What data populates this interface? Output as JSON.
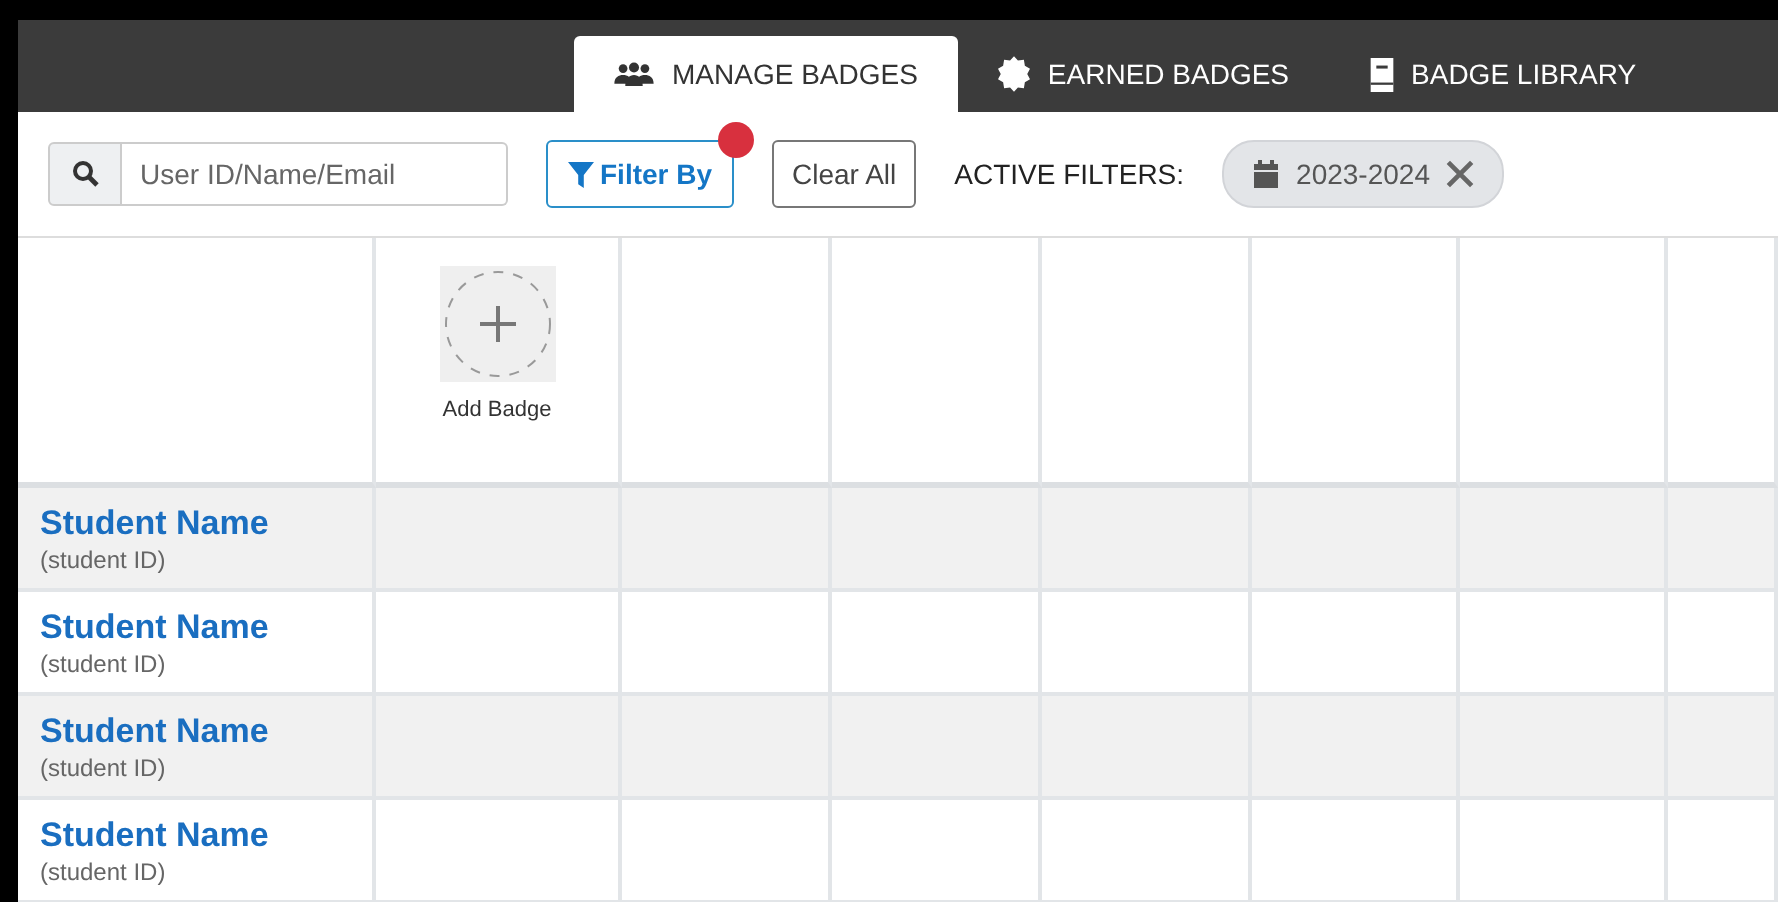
{
  "tabs": [
    {
      "label": "MANAGE BADGES",
      "selected": true
    },
    {
      "label": "EARNED BADGES",
      "selected": false
    },
    {
      "label": "BADGE LIBRARY",
      "selected": false
    }
  ],
  "toolbar": {
    "search": {
      "placeholder": "User ID/Name/Email"
    },
    "filter_button": {
      "label": "Filter By",
      "notification": true
    },
    "clear_button": "Clear All",
    "active_filters_label": "ACTIVE FILTERS:",
    "filters": [
      {
        "label": "2023-2024"
      }
    ]
  },
  "grid": {
    "add_badge": "Add Badge",
    "rows": [
      {
        "name": "Student Name",
        "id": "(student ID)"
      },
      {
        "name": "Student Name",
        "id": "(student ID)"
      },
      {
        "name": "Student Name",
        "id": "(student ID)"
      },
      {
        "name": "Student Name",
        "id": "(student ID)"
      }
    ]
  }
}
